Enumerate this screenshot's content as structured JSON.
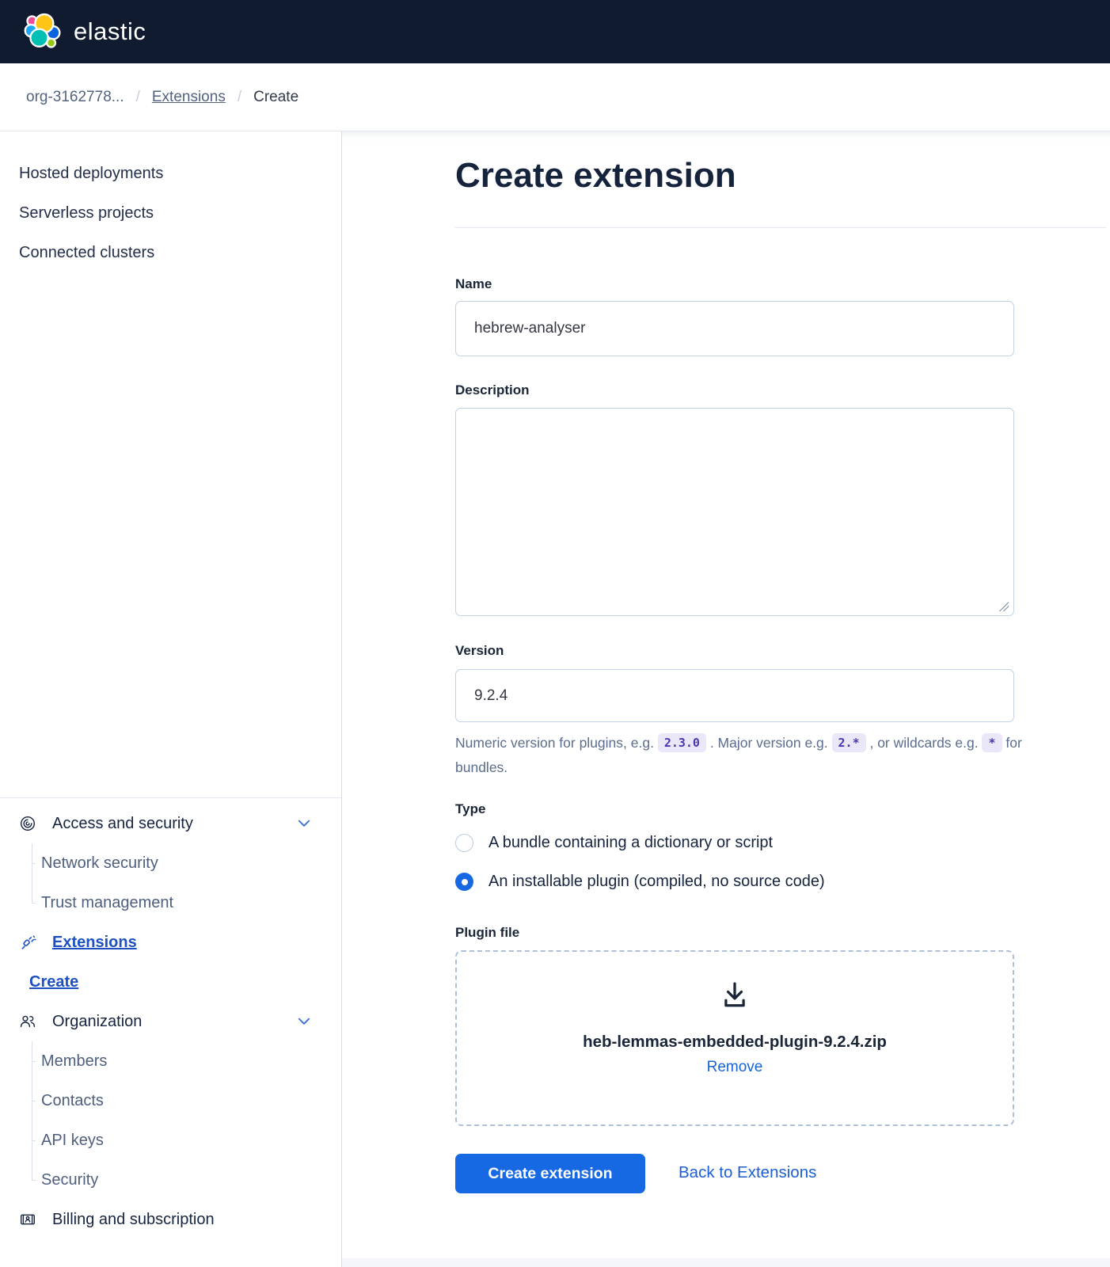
{
  "header": {
    "logo_text": "elastic"
  },
  "breadcrumb": {
    "separator": "/",
    "items": [
      "org-3162778...",
      "Extensions",
      "Create"
    ]
  },
  "sidebar": {
    "top_items": [
      "Hosted deployments",
      "Serverless projects",
      "Connected clusters"
    ],
    "access": {
      "label": "Access and security",
      "children": [
        "Network security",
        "Trust management"
      ]
    },
    "extensions_label": "Extensions",
    "create_label": "Create",
    "organization": {
      "label": "Organization",
      "children": [
        "Members",
        "Contacts",
        "API keys",
        "Security"
      ]
    },
    "billing_label": "Billing and subscription"
  },
  "form": {
    "title": "Create extension",
    "name": {
      "label": "Name",
      "value": "hebrew-analyser"
    },
    "description": {
      "label": "Description",
      "value": ""
    },
    "version": {
      "label": "Version",
      "value": "9.2.4",
      "hint": {
        "part1": "Numeric version for plugins, e.g. ",
        "code1": "2.3.0",
        "part2": " . Major version e.g. ",
        "code2": "2.*",
        "part3": " , or wildcards e.g. ",
        "code3": "*",
        "part4": " for bundles."
      }
    },
    "type": {
      "label": "Type",
      "options": [
        {
          "label": "A bundle containing a dictionary or script",
          "selected": false
        },
        {
          "label": "An installable plugin (compiled, no source code)",
          "selected": true
        }
      ]
    },
    "plugin_file": {
      "label": "Plugin file",
      "filename": "heb-lemmas-embedded-plugin-9.2.4.zip",
      "remove_label": "Remove"
    },
    "actions": {
      "submit_label": "Create extension",
      "back_label": "Back to Extensions"
    }
  },
  "icons": {
    "logo": "elastic-logo",
    "access": "access-security-icon",
    "extensions": "plug-icon",
    "organization": "people-icon",
    "billing": "billing-card-icon",
    "chevron": "chevron-down-icon",
    "upload": "import-download-icon"
  },
  "colors": {
    "header_bg": "#101b30",
    "primary_blue": "#1668e3",
    "sidebar_link_blue": "#1d50c0",
    "code_chip_bg": "#eae8f8",
    "code_chip_text": "#4f35b3"
  }
}
